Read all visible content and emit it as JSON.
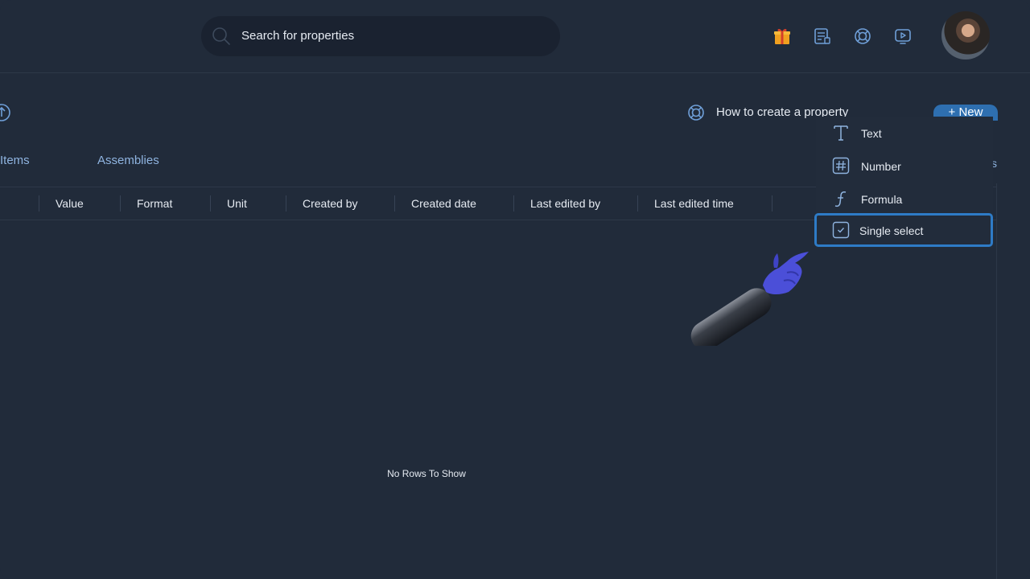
{
  "header": {
    "search_placeholder": "Search for properties",
    "icons": [
      "search-icon",
      "gift-icon",
      "document-icon",
      "help-lifebuoy-icon",
      "video-tutorial-icon",
      "user-avatar"
    ]
  },
  "toolbar": {
    "help_link": "How to create a property",
    "new_button": "+ New",
    "partial_label": "s"
  },
  "tabs": [
    {
      "label": "Items"
    },
    {
      "label": "Assemblies"
    }
  ],
  "grid": {
    "columns": [
      "Value",
      "Format",
      "Unit",
      "Created by",
      "Created date",
      "Last edited by",
      "Last edited time"
    ],
    "empty_message": "No Rows To Show"
  },
  "new_menu": {
    "items": [
      {
        "label": "Text",
        "icon": "text-type-icon"
      },
      {
        "label": "Number",
        "icon": "hash-icon"
      },
      {
        "label": "Formula",
        "icon": "formula-icon"
      },
      {
        "label": "Single select",
        "icon": "checkbox-icon",
        "selected": true
      }
    ]
  },
  "colors": {
    "background": "#212b3a",
    "accent": "#2e7bc6",
    "tab_text": "#8fb4e0"
  }
}
